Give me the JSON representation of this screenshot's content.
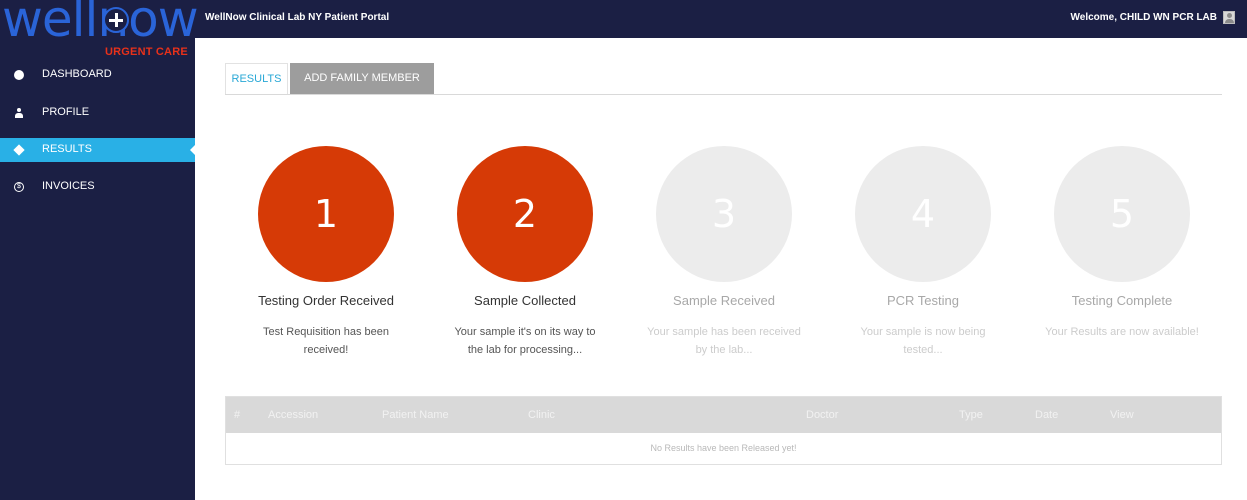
{
  "header": {
    "portal_title": "WellNow Clinical Lab NY Patient Portal",
    "welcome_text": "Welcome, CHILD WN PCR LAB",
    "user_icon": "user-avatar-icon"
  },
  "logo": {
    "brand": "wellnow",
    "subbrand": "URGENT CARE"
  },
  "sidebar": {
    "items": [
      {
        "label": "DASHBOARD",
        "icon": "dashboard-icon",
        "active": false
      },
      {
        "label": "PROFILE",
        "icon": "profile-icon",
        "active": false
      },
      {
        "label": "RESULTS",
        "icon": "tag-icon",
        "active": true
      },
      {
        "label": "INVOICES",
        "icon": "dollar-icon",
        "active": false
      }
    ]
  },
  "tabs": [
    {
      "label": "RESULTS",
      "active": true
    },
    {
      "label": "ADD FAMILY MEMBER",
      "active": false
    }
  ],
  "steps": [
    {
      "number": "1",
      "title": "Testing Order Received",
      "description": "Test Requisition has been received!",
      "status": "done"
    },
    {
      "number": "2",
      "title": "Sample Collected",
      "description": "Your sample it's on its way to the lab for processing...",
      "status": "done"
    },
    {
      "number": "3",
      "title": "Sample Received",
      "description": "Your sample has been received by the lab...",
      "status": "pending"
    },
    {
      "number": "4",
      "title": "PCR Testing",
      "description": "Your sample is now being tested...",
      "status": "pending"
    },
    {
      "number": "5",
      "title": "Testing Complete",
      "description": "Your Results are now available!",
      "status": "pending"
    }
  ],
  "results_table": {
    "columns": [
      "#",
      "Accession",
      "Patient Name",
      "Clinic",
      "Doctor",
      "Type",
      "Date",
      "View"
    ],
    "empty_message": "No Results have been Released yet!"
  },
  "colors": {
    "sidebar_bg": "#1b1f44",
    "active_nav": "#29b0e6",
    "step_done": "#d63a06",
    "step_pending": "#ececec"
  }
}
